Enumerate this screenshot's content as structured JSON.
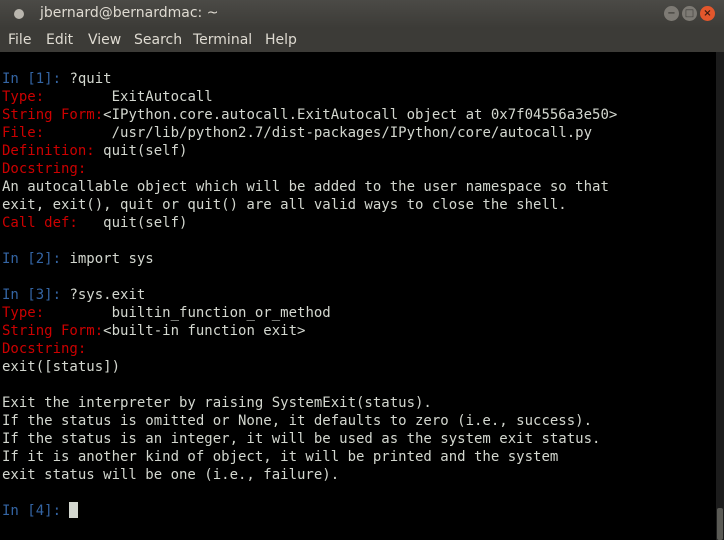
{
  "window": {
    "title": "jbernard@bernardmac: ~"
  },
  "menu": {
    "file": "File",
    "edit": "Edit",
    "view": "View",
    "search": "Search",
    "terminal": "Terminal",
    "help": "Help"
  },
  "terminal": {
    "in1_prompt": "In [1]:",
    "in1_cmd": "?quit",
    "quit_type_key": "Type:",
    "quit_type_val": "ExitAutocall",
    "quit_sf_key": "String Form:",
    "quit_sf_val": "<IPython.core.autocall.ExitAutocall object at 0x7f04556a3e50>",
    "quit_file_key": "File:",
    "quit_file_val": "/usr/lib/python2.7/dist-packages/IPython/core/autocall.py",
    "quit_def_key": "Definition:",
    "quit_def_val": "quit(self)",
    "quit_doc_key": "Docstring:",
    "quit_doc_1": "An autocallable object which will be added to the user namespace so that",
    "quit_doc_2": "exit, exit(), quit or quit() are all valid ways to close the shell.",
    "quit_call_key": "Call def:",
    "quit_call_val": "quit(self)",
    "in2_prompt": "In [2]:",
    "in2_cmd": "import sys",
    "in3_prompt": "In [3]:",
    "in3_cmd": "?sys.exit",
    "exit_type_key": "Type:",
    "exit_type_val": "builtin_function_or_method",
    "exit_sf_key": "String Form:",
    "exit_sf_val": "<built-in function exit>",
    "exit_doc_key": "Docstring:",
    "exit_sig": "exit([status])",
    "exit_doc_1": "Exit the interpreter by raising SystemExit(status).",
    "exit_doc_2": "If the status is omitted or None, it defaults to zero (i.e., success).",
    "exit_doc_3": "If the status is an integer, it will be used as the system exit status.",
    "exit_doc_4": "If it is another kind of object, it will be printed and the system",
    "exit_doc_5": "exit status will be one (i.e., failure).",
    "in4_prompt": "In [4]:"
  },
  "icons": {
    "app": "terminal-dot-icon",
    "minimize": "minimize-icon",
    "maximize": "maximize-icon",
    "close": "close-icon"
  },
  "colors": {
    "prompt": "#3465a4",
    "keyword": "#cc0000",
    "text": "#d3d7cf",
    "background": "#000000"
  }
}
